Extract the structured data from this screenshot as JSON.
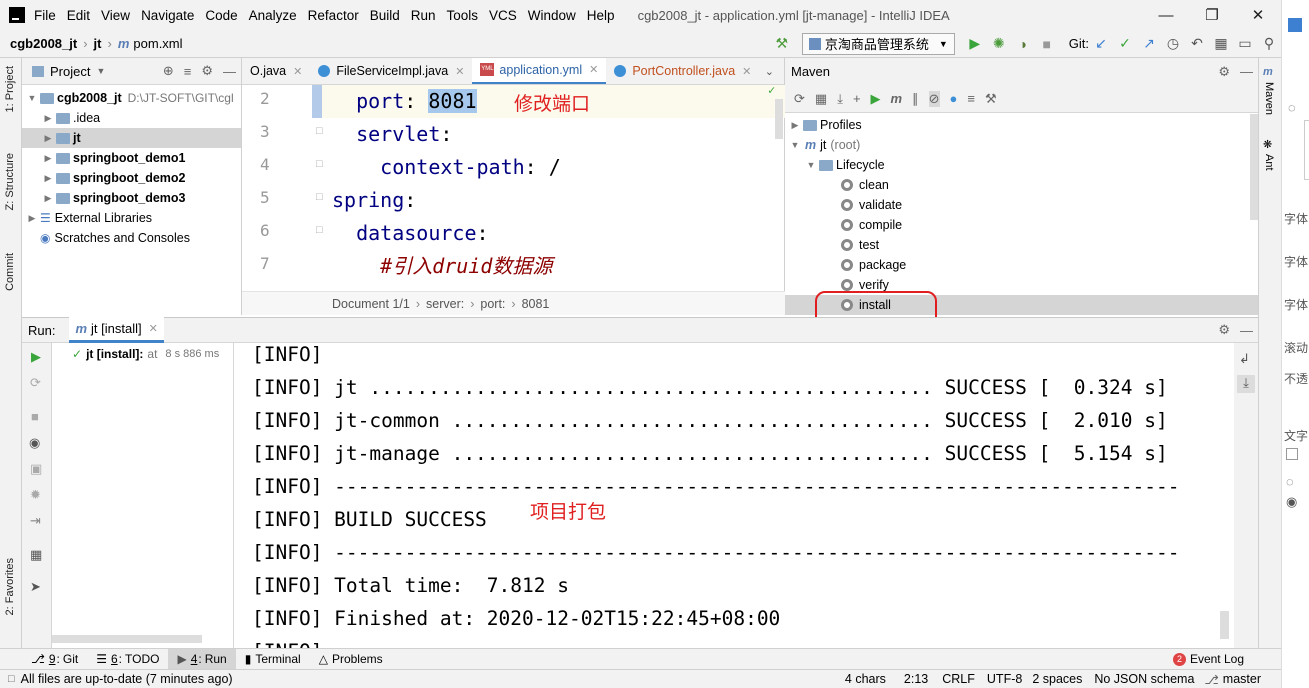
{
  "menubar": {
    "items": [
      "File",
      "Edit",
      "View",
      "Navigate",
      "Code",
      "Analyze",
      "Refactor",
      "Build",
      "Run",
      "Tools",
      "VCS",
      "Window",
      "Help"
    ],
    "title": "cgb2008_jt - application.yml [jt-manage] - IntelliJ IDEA"
  },
  "navbar": {
    "project": "cgb2008_jt",
    "module": "jt",
    "file": "pom.xml",
    "run_config": "京淘商品管理系统",
    "git_label": "Git:"
  },
  "left_strip": {
    "project": "1: Project",
    "structure": "Z: Structure",
    "commit": "Commit",
    "favorites": "2: Favorites"
  },
  "project_panel": {
    "title": "Project",
    "items": [
      {
        "label": "cgb2008_jt",
        "path": "D:\\JT-SOFT\\GIT\\cgl"
      },
      {
        "label": ".idea"
      },
      {
        "label": "jt"
      },
      {
        "label": "springboot_demo1"
      },
      {
        "label": "springboot_demo2"
      },
      {
        "label": "springboot_demo3"
      },
      {
        "label": "External Libraries"
      },
      {
        "label": "Scratches and Consoles"
      }
    ]
  },
  "editor": {
    "tabs": [
      {
        "label": "O.java"
      },
      {
        "label": "FileServiceImpl.java"
      },
      {
        "label": "application.yml"
      },
      {
        "label": "PortController.java"
      }
    ],
    "lines": [
      {
        "num": "2",
        "indent": "  ",
        "key": "port",
        "sep": ": ",
        "val": "8081"
      },
      {
        "num": "3",
        "indent": "  ",
        "key": "servlet",
        "sep": ":",
        "val": ""
      },
      {
        "num": "4",
        "indent": "    ",
        "key": "context-path",
        "sep": ": ",
        "val": "/"
      },
      {
        "num": "5",
        "indent": "",
        "key": "spring",
        "sep": ":",
        "val": ""
      },
      {
        "num": "6",
        "indent": "  ",
        "key": "datasource",
        "sep": ":",
        "val": ""
      },
      {
        "num": "7",
        "indent": "    ",
        "key": "",
        "sep": "",
        "val": "#引入druid数据源"
      }
    ],
    "annotation": "修改端口",
    "breadcrumb": [
      "Document 1/1",
      "server:",
      "port:",
      "8081"
    ]
  },
  "maven": {
    "title": "Maven",
    "profiles": "Profiles",
    "root": "jt",
    "root_suffix": "(root)",
    "lifecycle": "Lifecycle",
    "phases": [
      "clean",
      "validate",
      "compile",
      "test",
      "package",
      "verify",
      "install"
    ]
  },
  "right_strip": {
    "maven": "Maven",
    "ant": "Ant"
  },
  "far_right": [
    "字体",
    "字体",
    "字体",
    "滚动",
    "不透",
    "文字"
  ],
  "run_panel": {
    "label": "Run:",
    "tab": "jt [install]",
    "tree_item": "jt [install]:",
    "tree_at": "at",
    "tree_time": "8 s 886 ms"
  },
  "console": {
    "lines": [
      "[INFO]",
      "[INFO] jt ................................................ SUCCESS [  0.324 s]",
      "[INFO] jt-common ......................................... SUCCESS [  2.010 s]",
      "[INFO] jt-manage ......................................... SUCCESS [  5.154 s]",
      "[INFO] ------------------------------------------------------------------------",
      "[INFO] BUILD SUCCESS",
      "[INFO] ------------------------------------------------------------------------",
      "[INFO] Total time:  7.812 s",
      "[INFO] Finished at: 2020-12-02T15:22:45+08:00",
      "[INFO]"
    ],
    "annotation": "项目打包"
  },
  "bottom_tabs": [
    {
      "num": "9",
      "label": "Git"
    },
    {
      "num": "6",
      "label": "TODO"
    },
    {
      "num": "4",
      "label": "Run"
    },
    {
      "num": "",
      "label": "Terminal"
    },
    {
      "num": "",
      "label": "Problems"
    }
  ],
  "event_log": {
    "count": "2",
    "label": "Event Log"
  },
  "status": {
    "message": "All files are up-to-date (7 minutes ago)",
    "chars": "4 chars",
    "position": "2:13",
    "line_sep": "CRLF",
    "encoding": "UTF-8",
    "indent": "2 spaces",
    "schema": "No JSON schema",
    "branch": "master"
  },
  "colors": {
    "accent": "#4083c9",
    "annotation": "#e02020",
    "success": "#59a869"
  }
}
